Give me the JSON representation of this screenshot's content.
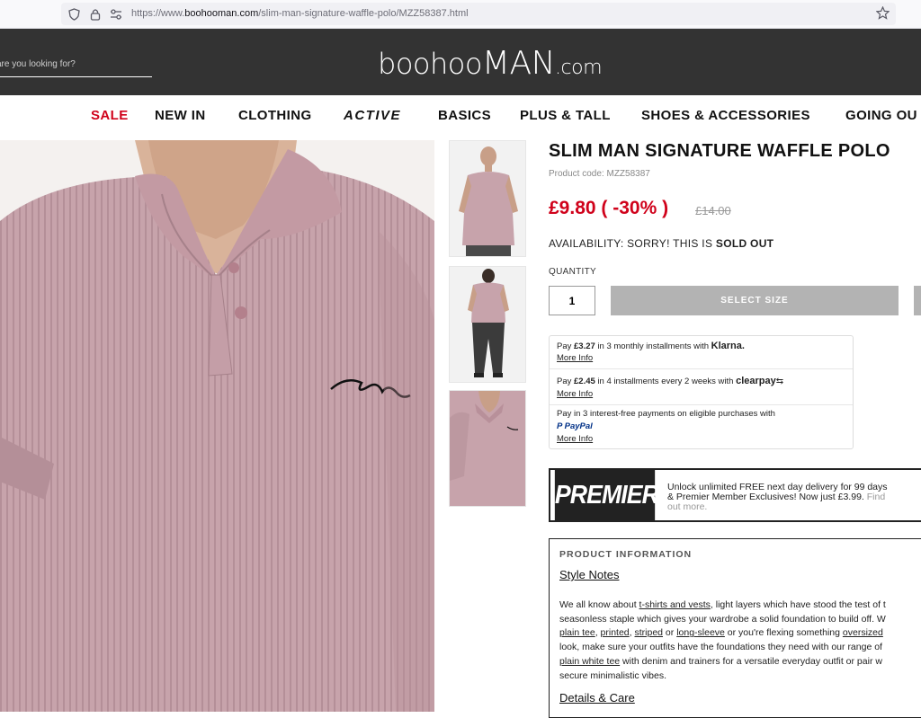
{
  "browser": {
    "url_prefix": "https://www.",
    "url_host": "boohooman.com",
    "url_path": "/slim-man-signature-waffle-polo/MZZ58387.html"
  },
  "header": {
    "search_placeholder": "are you looking for?",
    "logo_a": "boohoo",
    "logo_b": "MAN",
    "logo_c": ".com"
  },
  "nav": {
    "items": [
      "SALE",
      "NEW IN",
      "CLOTHING",
      "ACTIVE",
      "BASICS",
      "PLUS & TALL",
      "SHOES & ACCESSORIES",
      "GOING OU"
    ],
    "sale_color": "#d0021b"
  },
  "product": {
    "title": "SLIM MAN SIGNATURE WAFFLE POLO",
    "code": "Product code: MZZ58387",
    "price_now": "£9.80 ( -30% )",
    "price_was": "£14.00",
    "availability_label": "AVAILABILITY:  SORRY! THIS IS ",
    "availability_status": "SOLD OUT",
    "quantity_label": "QUANTITY",
    "quantity_value": "1",
    "select_size": "SELECT SIZE",
    "price_color": "#d0021b"
  },
  "payments": {
    "klarna_pre": "Pay ",
    "klarna_amount": "£3.27",
    "klarna_post": " in 3 monthly installments with ",
    "klarna_brand": "Klarna.",
    "clearpay_pre": "Pay ",
    "clearpay_amount": "£2.45",
    "clearpay_post": " in 4 installments every 2 weeks with ",
    "clearpay_brand": "clearpay",
    "paypal_text": "Pay in 3 interest-free payments on eligible purchases with",
    "paypal_brand": "PayPal",
    "more_info": "More Info"
  },
  "premier": {
    "logo": "PREMIER",
    "line1": "Unlock unlimited FREE next day delivery for 99 days",
    "line2": "& Premier Member Exclusives! Now just £3.99.",
    "find": "Find",
    "line3": "out more."
  },
  "info": {
    "heading": "PRODUCT INFORMATION",
    "style_notes": "Style Notes",
    "details_care": "Details & Care",
    "l1a": "We all know about ",
    "l1b": "t-shirts and vests",
    "l1c": ", light layers which have stood the test of t",
    "l2": "seasonless staple which gives your wardrobe a solid foundation to build off. W",
    "l3a": "plain tee",
    "l3b": ", ",
    "l3c": "printed",
    "l3d": ", ",
    "l3e": "striped",
    "l3f": " or ",
    "l3g": "long-sleeve",
    "l3h": " or you're flexing something ",
    "l3i": "oversized",
    "l4": "look, make sure your outfits have the foundations they need with our range of",
    "l5a": "plain white tee",
    "l5b": " with denim and trainers for a versatile everyday outfit or pair w",
    "l6": "secure minimalistic vibes."
  }
}
